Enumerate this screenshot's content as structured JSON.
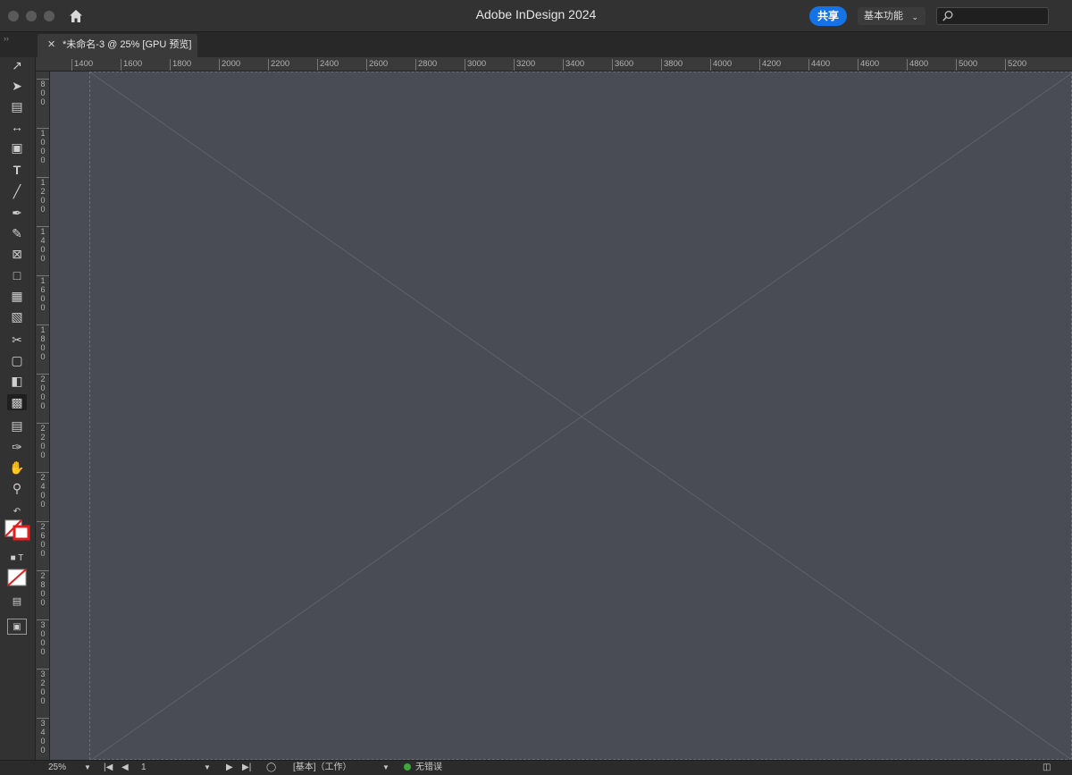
{
  "window": {
    "title": "Adobe InDesign 2024"
  },
  "header": {
    "share_label": "共享",
    "workspace_label": "基本功能",
    "search_placeholder": ""
  },
  "document": {
    "tab_label": "*未命名-3 @ 25% [GPU 预览]"
  },
  "ruler": {
    "horizontal": [
      "1400",
      "1600",
      "1800",
      "2000",
      "2200",
      "2400",
      "2600",
      "2800",
      "3000",
      "3200",
      "3400",
      "3600",
      "3800",
      "4000",
      "4200",
      "4400",
      "4600",
      "4800",
      "5000",
      "5200"
    ],
    "vertical": [
      "800",
      "1000",
      "1200",
      "1400",
      "1600",
      "1800",
      "2000",
      "2200",
      "2400",
      "2600",
      "2800",
      "3000",
      "3200",
      "3400"
    ]
  },
  "status": {
    "zoom": "25%",
    "page": "1",
    "style": "[基本]（工作）",
    "preflight": "无错误"
  },
  "colors": {
    "accent": "#1473e6",
    "status_ok": "#3ca83c"
  }
}
